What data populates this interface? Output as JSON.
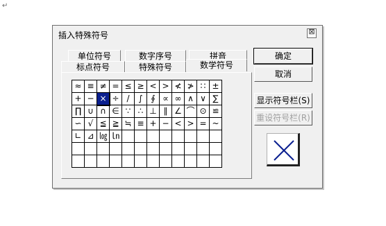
{
  "doc_mark": "↵",
  "dialog": {
    "title": "插入特殊符号",
    "close_symbol": "⊠"
  },
  "tabs_back": [
    {
      "label": "单位符号"
    },
    {
      "label": "数字序号"
    },
    {
      "label": "拼音"
    }
  ],
  "tabs_front": [
    {
      "label": "标点符号"
    },
    {
      "label": "特殊符号"
    },
    {
      "label": "数学符号",
      "active": true
    }
  ],
  "symbols": [
    "≈",
    "≡",
    "≠",
    "=",
    "≤",
    "≥",
    "<",
    ">",
    "≮",
    "≯",
    "∷",
    "±",
    "+",
    "−",
    "×",
    "÷",
    "/",
    "∫",
    "∮",
    "∝",
    "∞",
    "∧",
    "∨",
    "∑",
    "∏",
    "∪",
    "∩",
    "∈",
    "∵",
    "∴",
    "⊥",
    "∥",
    "∠",
    "⌒",
    "⊙",
    "≌",
    "∽",
    "√",
    "≦",
    "≧",
    "≒",
    "≡",
    "+",
    "−",
    "<",
    ">",
    "=",
    "~",
    "∟",
    "⊿",
    "㏒",
    "㏑",
    "",
    "",
    "",
    "",
    "",
    "",
    "",
    "",
    "",
    "",
    "",
    "",
    "",
    "",
    "",
    "",
    "",
    "",
    "",
    "",
    "",
    "",
    "",
    "",
    "",
    "",
    "",
    "",
    "",
    "",
    "",
    ""
  ],
  "selected_symbol": "×",
  "buttons": {
    "ok": "确定",
    "cancel": "取消",
    "show_bar": "显示符号栏(S)",
    "reset_bar": "重设符号栏(R)"
  },
  "preview_symbol": "×",
  "colors": {
    "selection": "#0a1f8f",
    "preview_stroke": "#0a1f8f"
  }
}
